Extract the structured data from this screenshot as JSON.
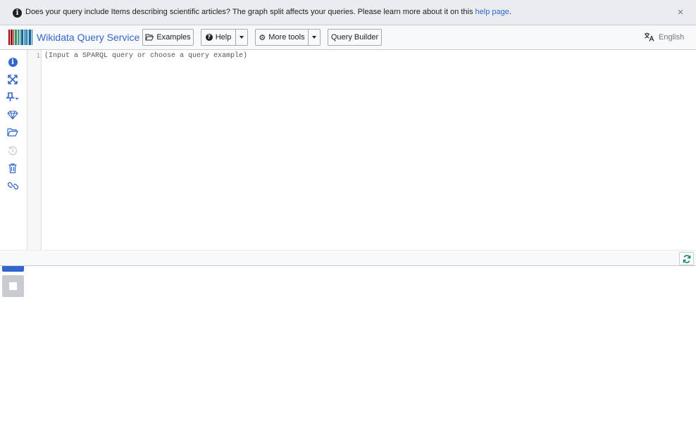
{
  "notice": {
    "text": "Does your query include Items describing scientific articles? The graph split affects your queries. Please learn more about it on this ",
    "link_text": "help page",
    "suffix": ".",
    "icon": "info-circle-icon",
    "close_label": "×"
  },
  "navbar": {
    "brand": "Wikidata Query Service",
    "examples_label": "Examples",
    "help_label": "Help",
    "more_tools_label": "More tools",
    "query_builder_label": "Query Builder",
    "language_label": "English"
  },
  "editor": {
    "line_number": "1",
    "placeholder": "(Input a SPARQL query or choose a query example)"
  },
  "sidebar": {
    "tools": [
      "info-icon",
      "expand-arrows-icon",
      "pin-dropdown-icon",
      "diamond-icon",
      "folder-open-icon",
      "history-icon",
      "trash-icon",
      "link-icon"
    ],
    "run": "play-icon",
    "stop": "stop-icon"
  },
  "colors": {
    "accent": "#3366cc",
    "notice_bg": "#eaecf0",
    "navbar_bg": "#f8f9fa",
    "icon": "#3366cc",
    "icon_disabled": "#c8ccd1"
  }
}
